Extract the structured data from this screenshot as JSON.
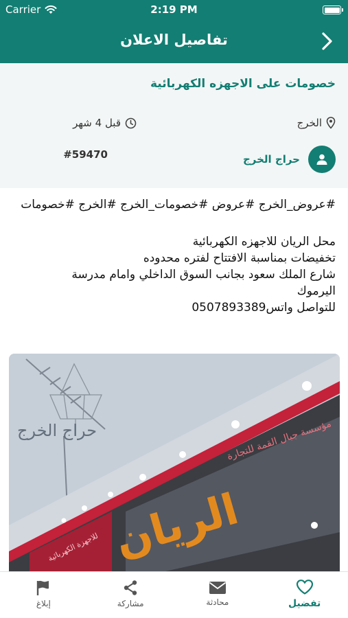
{
  "status_bar": {
    "carrier": "Carrier",
    "time": "2:19 PM"
  },
  "nav": {
    "title": "تفاصيل الاعلان",
    "back_icon": "chevron-right-icon"
  },
  "ad": {
    "title": "خصومات على الاجهزه الكهربائية",
    "location": "الخرج",
    "posted": "قبل 4 شهر",
    "seller": "حراج الخرج",
    "id": "#59470"
  },
  "description": {
    "hashtags": "#عروض_الخرج #عروض #خصومات_الخرج #الخرج #خصومات",
    "lines": [
      "محل الريان للاجهزه الكهربائية",
      "تخفيضات بمناسبة الافتتاح لفتره محدوده",
      "شارع الملك سعود بجانب السوق الداخلي وامام مدرسة",
      "اليرموك",
      "للتواصل واتس0507893389"
    ]
  },
  "photo": {
    "watermark": "حراج الخرج",
    "store_name": "الريان",
    "banner_text": "مؤسسة جبال القمة للتجارة",
    "side_text": "للاجهزة الكهربائية"
  },
  "tabs": [
    {
      "label": "تفضيل",
      "icon": "heart-icon",
      "active": true
    },
    {
      "label": "محادثة",
      "icon": "envelope-icon",
      "active": false
    },
    {
      "label": "مشاركة",
      "icon": "share-icon",
      "active": false
    },
    {
      "label": "إبلاغ",
      "icon": "flag-icon",
      "active": false
    }
  ],
  "colors": {
    "primary": "#137e73",
    "info_bg": "#f3f6f6"
  }
}
